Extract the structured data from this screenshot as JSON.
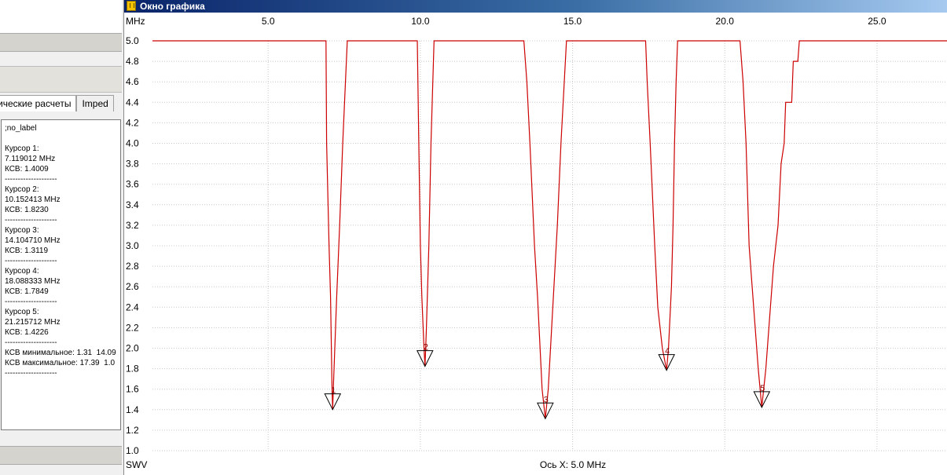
{
  "left_panel": {
    "tabs": [
      {
        "label": "ические расчеты"
      },
      {
        "label": "Imped"
      }
    ],
    "info_lines": [
      ";no_label",
      "",
      "Курсор 1:",
      "7.119012 MHz",
      "КСВ: 1.4009",
      "--------------------",
      "Курсор 2:",
      "10.152413 MHz",
      "КСВ: 1.8230",
      "--------------------",
      "Курсор 3:",
      "14.104710 MHz",
      "КСВ: 1.3119",
      "--------------------",
      "Курсор 4:",
      "18.088333 MHz",
      "КСВ: 1.7849",
      "--------------------",
      "Курсор 5:",
      "21.215712 MHz",
      "КСВ: 1.4226",
      "--------------------",
      "КСВ минимальное: 1.31  14.09",
      "КСВ максимальное: 17.39  1.0",
      "--------------------"
    ]
  },
  "graph_window": {
    "title": "Окно графика",
    "x_unit": "MHz",
    "y_name": "SWV",
    "x_axis_caption": "Ось X: 5.0 MHz",
    "colors": {
      "trace": "#cc0000",
      "grid": "#c8c8c8",
      "marker": "#8b0000"
    }
  },
  "chart_data": {
    "type": "line",
    "xlim": [
      1.2,
      27.3
    ],
    "ylim": [
      1.0,
      5.0
    ],
    "x_ticks": [
      5.0,
      10.0,
      15.0,
      20.0,
      25.0
    ],
    "x_tick_labels": [
      "5.0",
      "10.0",
      "15.0",
      "20.0",
      "25.0"
    ],
    "y_ticks": [
      1.0,
      1.2,
      1.4,
      1.6,
      1.8,
      2.0,
      2.2,
      2.4,
      2.6,
      2.8,
      3.0,
      3.2,
      3.4,
      3.6,
      3.8,
      4.0,
      4.2,
      4.4,
      4.6,
      4.8,
      5.0
    ],
    "y_tick_labels": [
      "1.0",
      "1.2",
      "1.4",
      "1.6",
      "1.8",
      "2.0",
      "2.2",
      "2.4",
      "2.6",
      "2.8",
      "3.0",
      "3.2",
      "3.4",
      "3.6",
      "3.8",
      "4.0",
      "4.2",
      "4.4",
      "4.6",
      "4.8",
      "5.0"
    ],
    "grid": true,
    "series": [
      {
        "points": [
          [
            1.2,
            5.0
          ],
          [
            6.9,
            5.0
          ],
          [
            6.92,
            4.0
          ],
          [
            7.0,
            3.0
          ],
          [
            7.05,
            2.5
          ],
          [
            7.1,
            1.6
          ],
          [
            7.119,
            1.4009
          ],
          [
            7.14,
            1.6
          ],
          [
            7.25,
            2.5
          ],
          [
            7.35,
            3.2
          ],
          [
            7.45,
            4.0
          ],
          [
            7.6,
            5.0
          ],
          [
            9.9,
            5.0
          ],
          [
            9.95,
            4.0
          ],
          [
            10.0,
            3.0
          ],
          [
            10.05,
            2.5
          ],
          [
            10.12,
            2.0
          ],
          [
            10.152,
            1.823
          ],
          [
            10.2,
            2.2
          ],
          [
            10.28,
            3.0
          ],
          [
            10.35,
            4.0
          ],
          [
            10.45,
            5.0
          ],
          [
            13.4,
            5.0
          ],
          [
            13.5,
            4.6
          ],
          [
            13.6,
            4.0
          ],
          [
            13.75,
            3.0
          ],
          [
            13.85,
            2.5
          ],
          [
            14.0,
            1.6
          ],
          [
            14.105,
            1.3119
          ],
          [
            14.2,
            1.6
          ],
          [
            14.35,
            2.4
          ],
          [
            14.5,
            3.2
          ],
          [
            14.62,
            4.0
          ],
          [
            14.8,
            5.0
          ],
          [
            17.4,
            5.0
          ],
          [
            17.45,
            4.6
          ],
          [
            17.55,
            4.0
          ],
          [
            17.7,
            3.0
          ],
          [
            17.8,
            2.4
          ],
          [
            17.95,
            2.0
          ],
          [
            18.088,
            1.7849
          ],
          [
            18.15,
            2.0
          ],
          [
            18.25,
            2.6
          ],
          [
            18.3,
            3.2
          ],
          [
            18.35,
            4.0
          ],
          [
            18.4,
            4.6
          ],
          [
            18.45,
            5.0
          ],
          [
            20.5,
            5.0
          ],
          [
            20.6,
            4.6
          ],
          [
            20.7,
            4.0
          ],
          [
            20.8,
            3.0
          ],
          [
            20.95,
            2.4
          ],
          [
            21.1,
            1.8
          ],
          [
            21.216,
            1.4226
          ],
          [
            21.35,
            1.8
          ],
          [
            21.5,
            2.4
          ],
          [
            21.6,
            2.8
          ],
          [
            21.75,
            3.2
          ],
          [
            21.85,
            3.8
          ],
          [
            21.95,
            4.0
          ],
          [
            22.0,
            4.4
          ],
          [
            22.2,
            4.4
          ],
          [
            22.25,
            4.8
          ],
          [
            22.4,
            4.8
          ],
          [
            22.45,
            5.0
          ],
          [
            27.3,
            5.0
          ]
        ]
      }
    ],
    "markers": [
      {
        "label": "1",
        "x": 7.119012,
        "y": 1.4009
      },
      {
        "label": "2",
        "x": 10.152413,
        "y": 1.823
      },
      {
        "label": "3",
        "x": 14.10471,
        "y": 1.3119
      },
      {
        "label": "4",
        "x": 18.088333,
        "y": 1.7849
      },
      {
        "label": "5",
        "x": 21.215712,
        "y": 1.4226
      }
    ]
  }
}
